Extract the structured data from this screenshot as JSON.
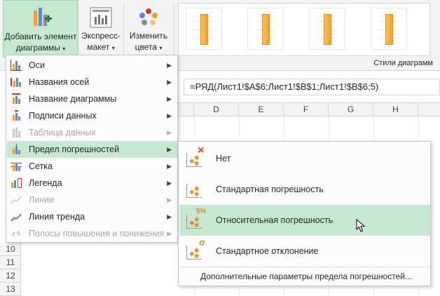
{
  "ribbon": {
    "add_element": {
      "line1": "Добавить элемент",
      "line2": "диаграммы"
    },
    "express": {
      "line1": "Экспресс-",
      "line2": "макет"
    },
    "colors": {
      "line1": "Изменить",
      "line2": "цвета"
    },
    "styles_label": "Стили диаграмм"
  },
  "formula_bar": {
    "value": "=РЯД(Лист1!$A$6;Лист1!$B$1;Лист1!$B$6;5)"
  },
  "columns": [
    "D",
    "E",
    "F",
    "G",
    "H"
  ],
  "rows": [
    "10",
    "11",
    "12",
    "13"
  ],
  "menu": {
    "items": [
      {
        "label": "Оси",
        "enabled": true
      },
      {
        "label": "Названия осей",
        "enabled": true
      },
      {
        "label": "Название диаграммы",
        "enabled": true
      },
      {
        "label": "Подписи данных",
        "enabled": true
      },
      {
        "label": "Таблица данных",
        "enabled": false
      },
      {
        "label": "Предел погрешностей",
        "enabled": true,
        "selected": true
      },
      {
        "label": "Сетка",
        "enabled": true
      },
      {
        "label": "Легенда",
        "enabled": true
      },
      {
        "label": "Линии",
        "enabled": false
      },
      {
        "label": "Линия тренда",
        "enabled": true
      },
      {
        "label": "Полосы повышения и понижения",
        "enabled": false
      }
    ]
  },
  "submenu": {
    "items": [
      {
        "label": "Нет",
        "badge": "×"
      },
      {
        "label": "Стандартная погрешность",
        "badge": ""
      },
      {
        "label": "Относительная погрешность",
        "badge": "5%",
        "highlighted": true
      },
      {
        "label": "Стандартное отклонение",
        "badge": "σ"
      }
    ],
    "more": "Дополнительные параметры предела погрешностей..."
  },
  "colors": {
    "selection": "#c6e7d0",
    "accent_orange": "#f0a030",
    "accent_red": "#d9342b"
  }
}
